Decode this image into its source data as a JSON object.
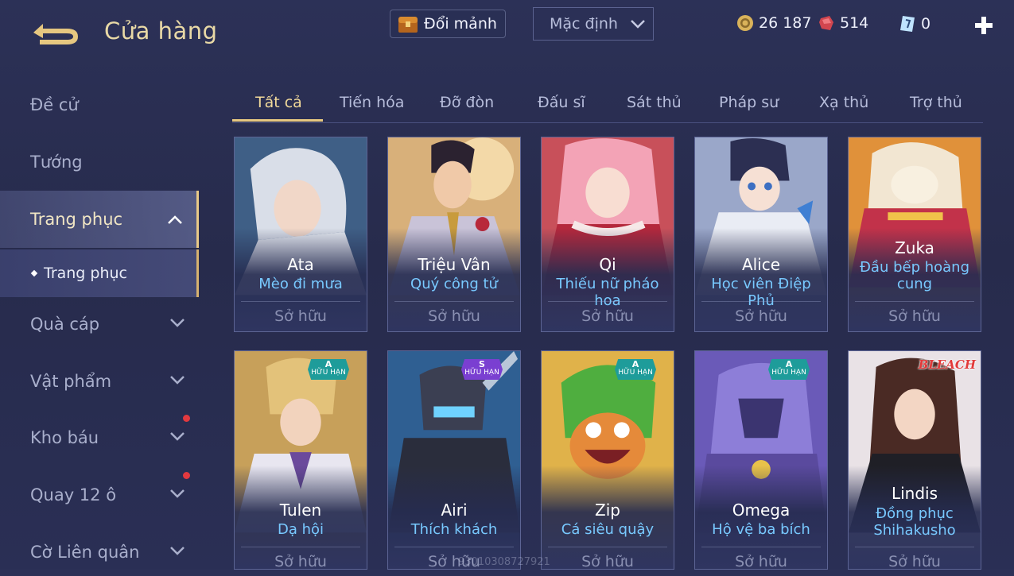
{
  "header": {
    "title": "Cửa hàng",
    "exchange_label": "Đổi mảnh",
    "sort_value": "Mặc định",
    "currencies": [
      {
        "name": "gold",
        "icon": "gold-coin-icon",
        "value": "26 187"
      },
      {
        "name": "ruby",
        "icon": "ruby-gem-icon",
        "value": "514"
      },
      {
        "name": "voucher",
        "icon": "voucher-card-icon",
        "value": "0"
      }
    ]
  },
  "sidebar": {
    "items": [
      {
        "label": "Đề cử"
      },
      {
        "label": "Tướng"
      },
      {
        "label": "Trang phục"
      },
      {
        "label": "Quà cáp"
      },
      {
        "label": "Vật phẩm"
      },
      {
        "label": "Kho báu"
      },
      {
        "label": "Quay 12 ô"
      },
      {
        "label": "Cờ Liên quân"
      }
    ],
    "sub_item": "Trang phục"
  },
  "tabs": [
    "Tất cả",
    "Tiến hóa",
    "Đỡ đòn",
    "Đấu sĩ",
    "Sát thủ",
    "Pháp sư",
    "Xạ thủ",
    "Trợ thủ"
  ],
  "cards": [
    {
      "hero": "Ata",
      "skin": "Mèo đi mưa",
      "status": "Sở hữu",
      "badge": ""
    },
    {
      "hero": "Triệu Vân",
      "skin": "Quý công tử",
      "status": "Sở hữu",
      "badge": ""
    },
    {
      "hero": "Qi",
      "skin": "Thiếu nữ pháo hoa",
      "status": "Sở hữu",
      "badge": ""
    },
    {
      "hero": "Alice",
      "skin": "Học viên Điệp Phủ",
      "status": "Sở hữu",
      "badge": ""
    },
    {
      "hero": "Zuka",
      "skin": "Đầu bếp hoàng cung",
      "status": "Sở hữu",
      "badge": ""
    },
    {
      "hero": "Tulen",
      "skin": "Dạ hội",
      "status": "Sở hữu",
      "badge": "A",
      "badge_text": "HỮU HẠN"
    },
    {
      "hero": "Airi",
      "skin": "Thích khách",
      "status": "Sở hữu",
      "badge": "S",
      "badge_text": "HỮU HẠN"
    },
    {
      "hero": "Zip",
      "skin": "Cá siêu quậy",
      "status": "Sở hữu",
      "badge": "A",
      "badge_text": "HỮU HẠN"
    },
    {
      "hero": "Omega",
      "skin": "Hộ vệ ba bích",
      "status": "Sở hữu",
      "badge": "A",
      "badge_text": "HỮU HẠN"
    },
    {
      "hero": "Lindis",
      "skin": "Đồng phục Shihakusho",
      "status": "Sở hữu",
      "badge": "BLEACH"
    }
  ],
  "watermark": "93010308727921",
  "colors": {
    "accent_gold": "#e6c780",
    "skin_blue": "#78c9ff",
    "badge_teal": "#1e9c9a",
    "badge_purple": "#7a3fd1"
  }
}
